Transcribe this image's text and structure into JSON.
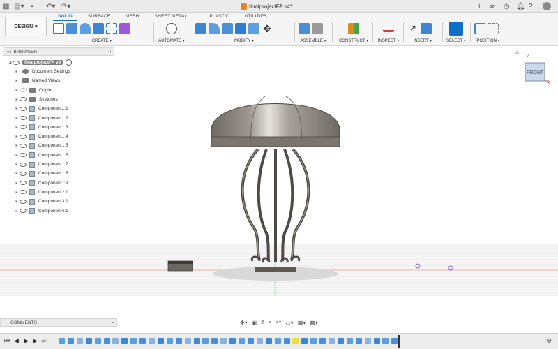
{
  "titlebar": {
    "document_title": "finalprojectFA v4*",
    "plus": "+"
  },
  "workspace": {
    "label": "DESIGN"
  },
  "tabs": [
    {
      "label": "SOLID",
      "active": true
    },
    {
      "label": "SURFACE",
      "active": false
    },
    {
      "label": "MESH",
      "active": false
    },
    {
      "label": "SHEET METAL",
      "active": false
    },
    {
      "label": "PLASTIC",
      "active": false
    },
    {
      "label": "UTILITIES",
      "active": false
    }
  ],
  "groups": [
    {
      "label": "CREATE ▾",
      "icon": "create-sketch-icon"
    },
    {
      "label": "AUTOMATE ▾",
      "icon": "automate-icon"
    },
    {
      "label": "MODIFY ▾",
      "icon": "press-pull-icon"
    },
    {
      "label": "ASSEMBLE ▾",
      "icon": "new-component-icon"
    },
    {
      "label": "CONSTRUCT ▾",
      "icon": "offset-plane-icon"
    },
    {
      "label": "INSPECT ▾",
      "icon": "measure-icon"
    },
    {
      "label": "INSERT ▾",
      "icon": "insert-image-icon"
    },
    {
      "label": "SELECT ▾",
      "icon": "select-icon"
    },
    {
      "label": "POSITION ▾",
      "icon": "position-icon"
    }
  ],
  "browser": {
    "title": "BROWSER",
    "root": "finalprojectFA v4",
    "items": [
      {
        "label": "Document Settings",
        "kind": "settings"
      },
      {
        "label": "Named Views",
        "kind": "folder"
      },
      {
        "label": "Origin",
        "kind": "folder"
      },
      {
        "label": "Sketches",
        "kind": "folder"
      },
      {
        "label": "Component1:1",
        "kind": "component"
      },
      {
        "label": "Component1:2",
        "kind": "component"
      },
      {
        "label": "Component1:3",
        "kind": "component"
      },
      {
        "label": "Component1:4",
        "kind": "component"
      },
      {
        "label": "Component1:5",
        "kind": "component"
      },
      {
        "label": "Component1:6",
        "kind": "component"
      },
      {
        "label": "Component1:7",
        "kind": "component"
      },
      {
        "label": "Component1:8",
        "kind": "component"
      },
      {
        "label": "Component1:9",
        "kind": "component"
      },
      {
        "label": "Component2:1",
        "kind": "component"
      },
      {
        "label": "Component3:1",
        "kind": "component"
      },
      {
        "label": "Component4:1",
        "kind": "component"
      }
    ]
  },
  "viewcube": {
    "face": "FRONT",
    "axis_z": "Z",
    "axis_x": "X"
  },
  "comments": {
    "title": "COMMENTS"
  },
  "colors": {
    "accent": "#0f6fc6",
    "lamp_shade": "#8d8881",
    "grid": "#e9e9e9"
  }
}
